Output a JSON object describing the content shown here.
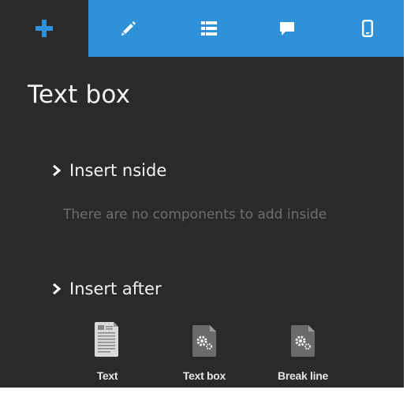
{
  "tabs": [
    {
      "icon": "plus-icon",
      "active": true
    },
    {
      "icon": "pencil-icon",
      "active": false
    },
    {
      "icon": "list-icon",
      "active": false
    },
    {
      "icon": "comment-icon",
      "active": false
    },
    {
      "icon": "mobile-icon",
      "active": false
    }
  ],
  "colors": {
    "accent": "#2f92d8",
    "panel_bg": "#2a2a2c",
    "text": "#f2f2f2",
    "muted_text": "#6e6e6e"
  },
  "panel": {
    "title": "Text box"
  },
  "insert_inside": {
    "heading": "Insert nside",
    "empty_message": "There are no components to add inside"
  },
  "insert_after": {
    "heading": "Insert after",
    "components": [
      {
        "label": "Text",
        "icon": "text-document-icon"
      },
      {
        "label": "Text box",
        "icon": "gear-document-icon"
      },
      {
        "label": "Break line",
        "icon": "gear-document-icon"
      }
    ]
  }
}
